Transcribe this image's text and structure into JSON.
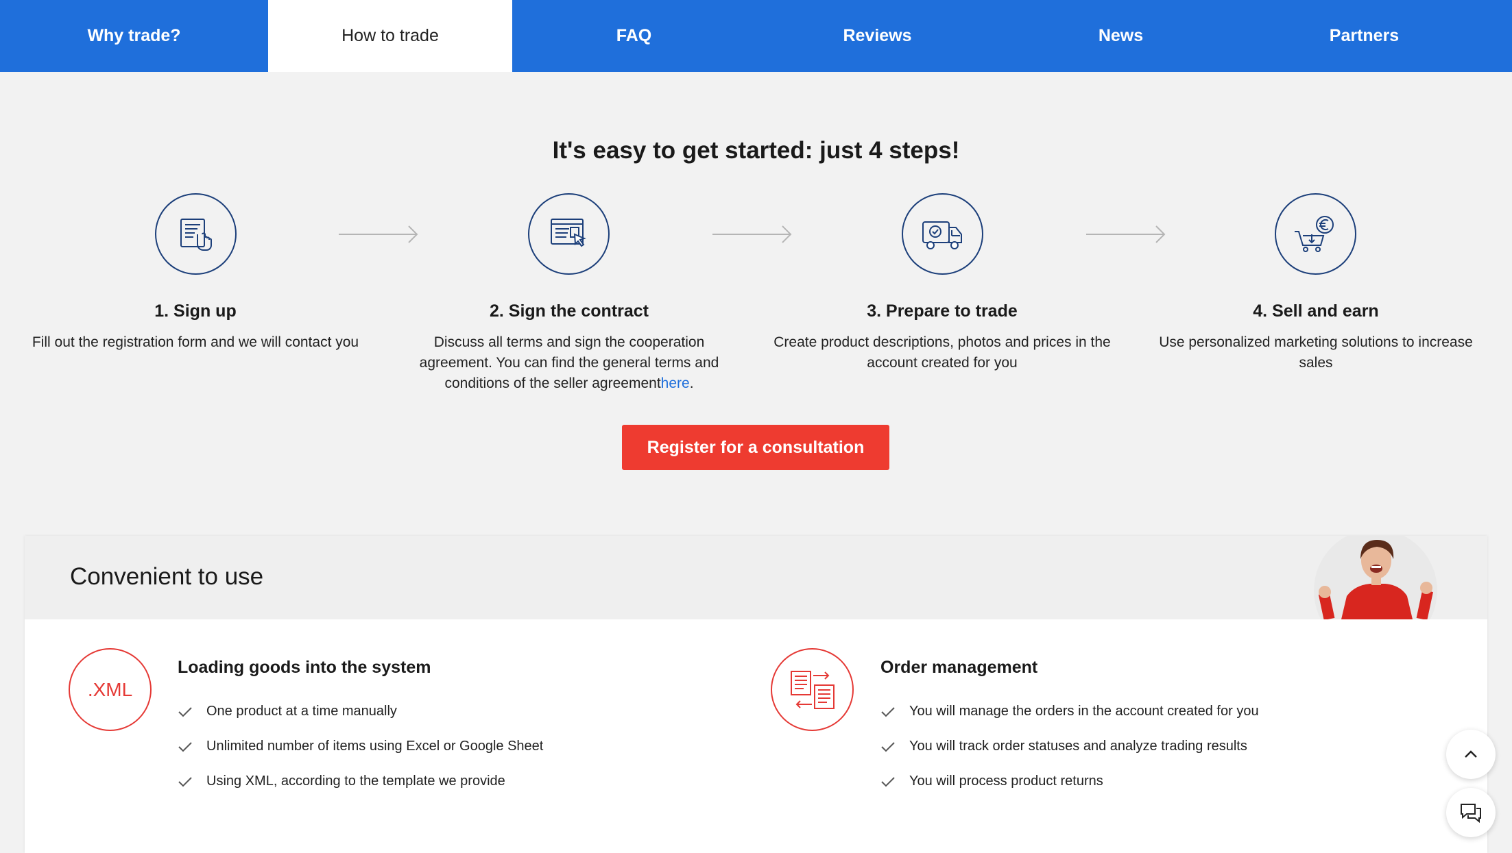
{
  "nav": {
    "tabs": [
      {
        "label": "Why trade?"
      },
      {
        "label": "How to trade"
      },
      {
        "label": "FAQ"
      },
      {
        "label": "Reviews"
      },
      {
        "label": "News"
      },
      {
        "label": "Partners"
      }
    ],
    "active": "How to trade"
  },
  "steps": {
    "headline": "It's easy to get started: just 4 steps!",
    "items": [
      {
        "title": "1. Sign up",
        "desc": "Fill out the registration form and we will contact you",
        "icon": "form-hand-icon"
      },
      {
        "title": "2. Sign the contract",
        "desc": "Discuss all terms and sign the cooperation agreement. You can find the general terms and conditions of the seller agreement",
        "link": "here",
        "suffix": ".",
        "icon": "contract-cursor-icon"
      },
      {
        "title": "3. Prepare to trade",
        "desc": "Create product descriptions, photos and prices in the account created for you",
        "icon": "delivery-truck-icon"
      },
      {
        "title": "4. Sell and earn",
        "desc": "Use personalized marketing solutions to increase sales",
        "icon": "cart-euro-icon"
      }
    ],
    "cta": "Register for a consultation"
  },
  "convenient": {
    "title": "Convenient to use",
    "features": [
      {
        "icon_text": ".XML",
        "title": "Loading goods into the system",
        "items": [
          "One product at a time manually",
          "Unlimited number of items using Excel or Google Sheet",
          "Using XML, according to the template we provide"
        ]
      },
      {
        "icon": "order-exchange-icon",
        "title": "Order management",
        "items": [
          "You will manage the orders in the account created for you",
          "You will track order statuses and analyze trading results",
          "You will process product returns"
        ]
      }
    ]
  },
  "colors": {
    "nav_blue": "#1f6fdb",
    "cta_red": "#ee3b30",
    "icon_navy": "#1c3f7a",
    "feature_red": "#e53935"
  }
}
